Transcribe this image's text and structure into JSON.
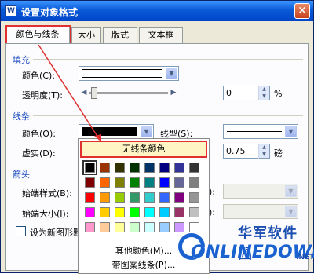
{
  "window": {
    "title": "设置对象格式",
    "icon_glyph": "W",
    "close_glyph": "×"
  },
  "tabs": [
    {
      "label": "颜色与线条"
    },
    {
      "label": "大小"
    },
    {
      "label": "版式"
    },
    {
      "label": "文本框"
    }
  ],
  "fill": {
    "group_title": "填充",
    "color_label": "颜色(C):",
    "color_value": "#ffffff",
    "transparency_label": "透明度(T):",
    "transparency_value": "0",
    "transparency_unit": "%"
  },
  "line": {
    "group_title": "线条",
    "color_label": "颜色(O):",
    "color_value": "#000000",
    "style_label": "线型(S):",
    "dash_label": "虚实(D):",
    "weight_value": "0.75",
    "weight_unit": "磅"
  },
  "arrows": {
    "group_title": "箭头",
    "begin_style_label": "始端样式(B):",
    "begin_size_label": "始端大小(I):",
    "end_style_label_fragment": "):",
    "end_size_label_fragment": "):"
  },
  "default_checkbox_label": "设为新图形默",
  "color_popup": {
    "no_line_label": "无线条颜色",
    "more_colors_label": "其他颜色(M)...",
    "pattern_line_label": "带图案线条(P)...",
    "swatches": [
      [
        "#000000",
        "#993300",
        "#333300",
        "#003300",
        "#003366",
        "#000080",
        "#333399",
        "#333333"
      ],
      [
        "#800000",
        "#ff6600",
        "#808000",
        "#008000",
        "#008080",
        "#0000ff",
        "#666699",
        "#808080"
      ],
      [
        "#ff0000",
        "#ff9900",
        "#99cc00",
        "#339966",
        "#33cccc",
        "#3366ff",
        "#800080",
        "#969696"
      ],
      [
        "#ff00ff",
        "#ffcc00",
        "#ffff00",
        "#00ff00",
        "#00ffff",
        "#00ccff",
        "#993366",
        "#c0c0c0"
      ],
      [
        "#ff99cc",
        "#ffcc99",
        "#ffff99",
        "#ccffcc",
        "#ccffff",
        "#99ccff",
        "#cc99ff",
        "#ffffff"
      ]
    ]
  },
  "watermark": {
    "cn_text": "华军软件园",
    "en_text": "ONLINEDOWN",
    "net_text": ".NET"
  },
  "accent_colors": {
    "highlight": "#e03030",
    "title_bar": "#0a5ad8"
  },
  "glyphs": {
    "dropdown": "▼",
    "left_arrow": "◀",
    "right_arrow": "▶",
    "spin_up": "▲",
    "spin_down": "▼"
  }
}
